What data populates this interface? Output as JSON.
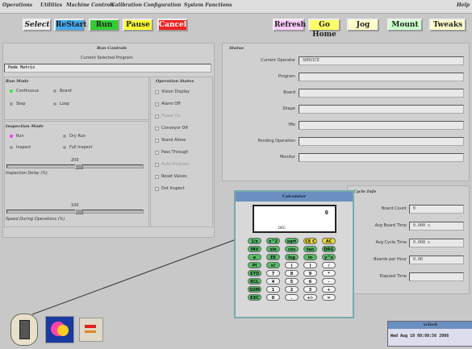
{
  "menu": [
    "Operations",
    "Utilities",
    "Machine Controls",
    "Calibration",
    "Configuration",
    "System Functions"
  ],
  "help": "Help",
  "toolbar": {
    "select": "Select",
    "restart": "ReStart",
    "run": "Run",
    "pause": "Pause",
    "cancel": "Cancel",
    "refresh": "Refresh",
    "gohome": "Go Home",
    "jog": "Jog",
    "mount": "Mount",
    "tweaks": "Tweaks"
  },
  "run_controls": {
    "title": "Run Controls",
    "current_program_label": "Current Selected Program",
    "program_value": "Pede Matrix",
    "run_mode_title": "Run Mode",
    "run_modes": [
      "Continuous",
      "Board",
      "Step",
      "Loop"
    ],
    "inspection_mode_title": "Inspection Mode",
    "inspection_modes": [
      "Run",
      "Dry Run",
      "Inspect",
      "Full Inspect"
    ],
    "slider1_value": "200",
    "inspection_delay_label": "Inspection Delay (%)",
    "slider2_value": "100",
    "speed_label": "Speed During Operations (%)",
    "op_states_title": "Operation States",
    "op_states": [
      "Vision Display",
      "Alarm Off",
      "Power On",
      "Conveyor Off",
      "Stand Alone",
      "Pass Through",
      "Auto Program",
      "Reset Valves",
      "Dot Inspect"
    ]
  },
  "status": {
    "title": "Status",
    "rows": [
      {
        "label": "Current Operator",
        "value": "SERVICE"
      },
      {
        "label": "Program",
        "value": ""
      },
      {
        "label": "Board",
        "value": ""
      },
      {
        "label": "Shape",
        "value": ""
      },
      {
        "label": "Hfe",
        "value": ""
      },
      {
        "label": "Pending Operation",
        "value": ""
      },
      {
        "label": "Monitor",
        "value": ""
      }
    ]
  },
  "cycle": {
    "title": "Cycle Info",
    "rows": [
      {
        "label": "Board Count",
        "value": "0"
      },
      {
        "label": "Avg Board Time",
        "value": "0.000 s"
      },
      {
        "label": "Avg Cycle Time",
        "value": "0.000 s"
      },
      {
        "label": "Boards per Hour",
        "value": "0.00"
      },
      {
        "label": "Elapsed Time",
        "value": ""
      }
    ]
  },
  "calculator": {
    "title": "Calculator",
    "display_value": "0",
    "mode": "DEG",
    "keys": [
      [
        "1/x",
        "x^2",
        "sqrt",
        "CE C",
        "AC"
      ],
      [
        "INV",
        "sin",
        "cos",
        "tan",
        "DRG"
      ],
      [
        "e",
        "EE",
        "log",
        "ln",
        "y^x"
      ],
      [
        "PI",
        "x!",
        "(",
        ")",
        "/"
      ],
      [
        "STO",
        "7",
        "8",
        "9",
        "*"
      ],
      [
        "RCL",
        "4",
        "5",
        "6",
        "-"
      ],
      [
        "SUM",
        "1",
        "2",
        "3",
        "+"
      ],
      [
        "EXC",
        "0",
        ".",
        "+/-",
        "="
      ]
    ]
  },
  "clock": {
    "title": "xclock",
    "value": "Wed Aug 10 08:08:56 2006"
  },
  "colors": {
    "run": "#33cc33",
    "pause": "#ffff33",
    "cancel": "#ee2222",
    "restart": "#44aaee",
    "refresh": "#ffccff",
    "gohome": "#ffff66",
    "jog": "#ffffcc",
    "mount": "#ccffcc",
    "tweaks": "#ffffcc"
  }
}
